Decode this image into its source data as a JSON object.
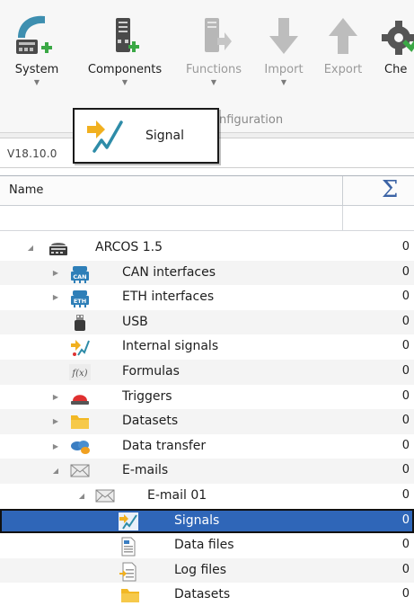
{
  "ribbon": {
    "buttons": [
      {
        "label": "System",
        "enabled": true
      },
      {
        "label": "Components",
        "enabled": true
      },
      {
        "label": "Functions",
        "enabled": false
      },
      {
        "label": "Import",
        "enabled": false
      },
      {
        "label": "Export",
        "enabled": false
      },
      {
        "label": "Che",
        "enabled": true
      }
    ],
    "group_label": "onfiguration"
  },
  "popup": {
    "item_label": "Signal",
    "icon": "signal-icon"
  },
  "version": "V18.10.0",
  "grid": {
    "column_name": "Name",
    "column_sum_symbol": "Σ",
    "rows": [
      {
        "label": "ARCOS 1.5",
        "value": "0",
        "icon": "device-icon",
        "expander": "expanded"
      },
      {
        "label": "CAN interfaces",
        "value": "0",
        "icon": "can-icon",
        "expander": "collapsed"
      },
      {
        "label": "ETH interfaces",
        "value": "0",
        "icon": "eth-icon",
        "expander": "collapsed"
      },
      {
        "label": "USB",
        "value": "0",
        "icon": "usb-icon",
        "expander": "none"
      },
      {
        "label": "Internal signals",
        "value": "0",
        "icon": "internal-signals-icon",
        "expander": "none"
      },
      {
        "label": "Formulas",
        "value": "0",
        "icon": "formula-icon",
        "expander": "none"
      },
      {
        "label": "Triggers",
        "value": "0",
        "icon": "trigger-icon",
        "expander": "collapsed"
      },
      {
        "label": "Datasets",
        "value": "0",
        "icon": "folder-icon",
        "expander": "collapsed"
      },
      {
        "label": "Data transfer",
        "value": "0",
        "icon": "data-transfer-icon",
        "expander": "collapsed"
      },
      {
        "label": "E-mails",
        "value": "0",
        "icon": "email-icon",
        "expander": "expanded"
      },
      {
        "label": "E-mail 01",
        "value": "0",
        "icon": "email-icon",
        "expander": "expanded"
      },
      {
        "label": "Signals",
        "value": "0",
        "icon": "signals-icon",
        "expander": "none",
        "selected": true
      },
      {
        "label": "Data files",
        "value": "0",
        "icon": "data-file-icon",
        "expander": "none"
      },
      {
        "label": "Log files",
        "value": "0",
        "icon": "log-file-icon",
        "expander": "none"
      },
      {
        "label": "Datasets",
        "value": "0",
        "icon": "folder-icon",
        "expander": "none"
      }
    ]
  },
  "colors": {
    "accent": "#2f66b8",
    "sigma": "#3b63a5",
    "green_plus": "#3aa845",
    "teal": "#2e8ca8"
  }
}
